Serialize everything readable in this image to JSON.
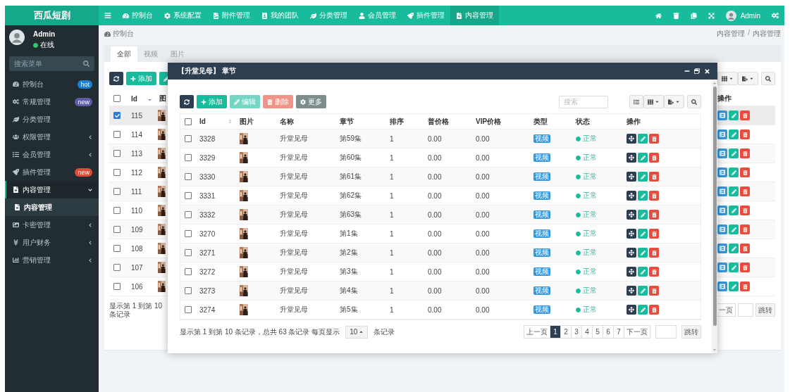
{
  "topbar": {
    "logo": "西瓜短剧",
    "nav": [
      {
        "label": "控制台",
        "selected": false
      },
      {
        "label": "系统配置",
        "selected": false
      },
      {
        "label": "附件管理",
        "selected": false
      },
      {
        "label": "我的团队",
        "selected": false
      },
      {
        "label": "分类管理",
        "selected": false
      },
      {
        "label": "会员管理",
        "selected": false
      },
      {
        "label": "插件管理",
        "selected": false
      },
      {
        "label": "内容管理",
        "selected": true
      }
    ],
    "user": "Admin"
  },
  "sidebar": {
    "user": {
      "name": "Admin",
      "status": "在线"
    },
    "search_placeholder": "搜索菜单",
    "items": [
      {
        "label": "控制台",
        "badge": {
          "text": "hot",
          "color": "#1f7fd0"
        },
        "selected": false
      },
      {
        "label": "常规管理",
        "badge": {
          "text": "new",
          "color": "#605ca8"
        },
        "selected": false
      },
      {
        "label": "分类管理",
        "selected": false
      },
      {
        "label": "权限管理",
        "expanded": false,
        "selected": false
      },
      {
        "label": "会员管理",
        "expanded": false,
        "selected": false
      },
      {
        "label": "插件管理",
        "badge": {
          "text": "new",
          "color": "#dd4b39"
        },
        "selected": false
      },
      {
        "label": "内容管理",
        "expanded": true,
        "selected": true,
        "children": [
          {
            "label": "内容管理",
            "selected": true
          }
        ]
      },
      {
        "label": "卡密管理",
        "expanded": false,
        "selected": false
      },
      {
        "label": "用户财务",
        "expanded": false,
        "selected": false
      },
      {
        "label": "营销管理",
        "expanded": false,
        "selected": false
      }
    ]
  },
  "breadcrumb": {
    "title": "控制台",
    "path": [
      "内容管理",
      "内容管理"
    ],
    "separator": "/"
  },
  "panel": {
    "tabs": [
      {
        "label": "全部",
        "selected": true
      },
      {
        "label": "视频",
        "selected": false
      },
      {
        "label": "图片",
        "selected": false
      }
    ],
    "toolbar": {
      "add": "添加"
    },
    "table": {
      "header_checked": false,
      "columns": [
        "Id",
        "图"
      ],
      "rows": [
        {
          "id": "115",
          "checked": true
        },
        {
          "id": "114",
          "checked": false
        },
        {
          "id": "113",
          "checked": false
        },
        {
          "id": "112",
          "checked": false
        },
        {
          "id": "111",
          "checked": false
        },
        {
          "id": "110",
          "checked": false
        },
        {
          "id": "109",
          "checked": false
        },
        {
          "id": "108",
          "checked": false
        },
        {
          "id": "107",
          "checked": false
        },
        {
          "id": "106",
          "checked": false
        }
      ],
      "ops_header": "操作"
    },
    "footer": {
      "summary": "显示第 1 到第 10 条记录",
      "next": "一页",
      "jump": "跳转"
    }
  },
  "dialog": {
    "title": "【升堂见母】 章节",
    "toolbar": {
      "buttons": [
        {
          "kind": "refresh",
          "disabled": false
        },
        {
          "kind": "add",
          "label": "添加",
          "disabled": false
        },
        {
          "kind": "edit",
          "label": "编辑",
          "disabled": true
        },
        {
          "kind": "delete",
          "label": "删除",
          "disabled": true
        },
        {
          "kind": "more",
          "label": "更多",
          "disabled": false
        }
      ],
      "search_placeholder": "搜索"
    },
    "header_checked": false,
    "columns": [
      "Id",
      "图片",
      "名称",
      "章节",
      "排序",
      "普价格",
      "VIP价格",
      "类型",
      "状态",
      "操作"
    ],
    "rows": [
      {
        "id": "3328",
        "name": "升堂见母",
        "chapter": "第59集",
        "sort": "1",
        "price": "0.00",
        "vip_price": "0.00",
        "type": "视频",
        "status": "正常",
        "checked": false
      },
      {
        "id": "3329",
        "name": "升堂见母",
        "chapter": "第60集",
        "sort": "1",
        "price": "0.00",
        "vip_price": "0.00",
        "type": "视频",
        "status": "正常",
        "checked": false
      },
      {
        "id": "3330",
        "name": "升堂见母",
        "chapter": "第61集",
        "sort": "1",
        "price": "0.00",
        "vip_price": "0.00",
        "type": "视频",
        "status": "正常",
        "checked": false
      },
      {
        "id": "3331",
        "name": "升堂见母",
        "chapter": "第62集",
        "sort": "1",
        "price": "0.00",
        "vip_price": "0.00",
        "type": "视频",
        "status": "正常",
        "checked": false
      },
      {
        "id": "3332",
        "name": "升堂见母",
        "chapter": "第63集",
        "sort": "1",
        "price": "0.00",
        "vip_price": "0.00",
        "type": "视频",
        "status": "正常",
        "checked": false
      },
      {
        "id": "3270",
        "name": "升堂见母",
        "chapter": "第1集",
        "sort": "1",
        "price": "0.00",
        "vip_price": "0.00",
        "type": "视频",
        "status": "正常",
        "checked": false
      },
      {
        "id": "3271",
        "name": "升堂见母",
        "chapter": "第2集",
        "sort": "1",
        "price": "0.00",
        "vip_price": "0.00",
        "type": "视频",
        "status": "正常",
        "checked": false
      },
      {
        "id": "3272",
        "name": "升堂见母",
        "chapter": "第3集",
        "sort": "1",
        "price": "0.00",
        "vip_price": "0.00",
        "type": "视频",
        "status": "正常",
        "checked": false
      },
      {
        "id": "3273",
        "name": "升堂见母",
        "chapter": "第4集",
        "sort": "1",
        "price": "0.00",
        "vip_price": "0.00",
        "type": "视频",
        "status": "正常",
        "checked": false
      },
      {
        "id": "3274",
        "name": "升堂见母",
        "chapter": "第5集",
        "sort": "1",
        "price": "0.00",
        "vip_price": "0.00",
        "type": "视频",
        "status": "正常",
        "checked": false
      }
    ],
    "footer": {
      "summary": "显示第 1 到第 10 条记录，总共 63 条记录 每页显示",
      "page_size": "10",
      "suffix": "条记录",
      "prev": "上一页",
      "pages": [
        {
          "label": "1",
          "selected": true
        },
        {
          "label": "2",
          "selected": false
        },
        {
          "label": "3",
          "selected": false
        },
        {
          "label": "4",
          "selected": false
        },
        {
          "label": "5",
          "selected": false
        },
        {
          "label": "6",
          "selected": false
        },
        {
          "label": "7",
          "selected": false
        }
      ],
      "next": "下一页",
      "jump": "跳转"
    }
  }
}
